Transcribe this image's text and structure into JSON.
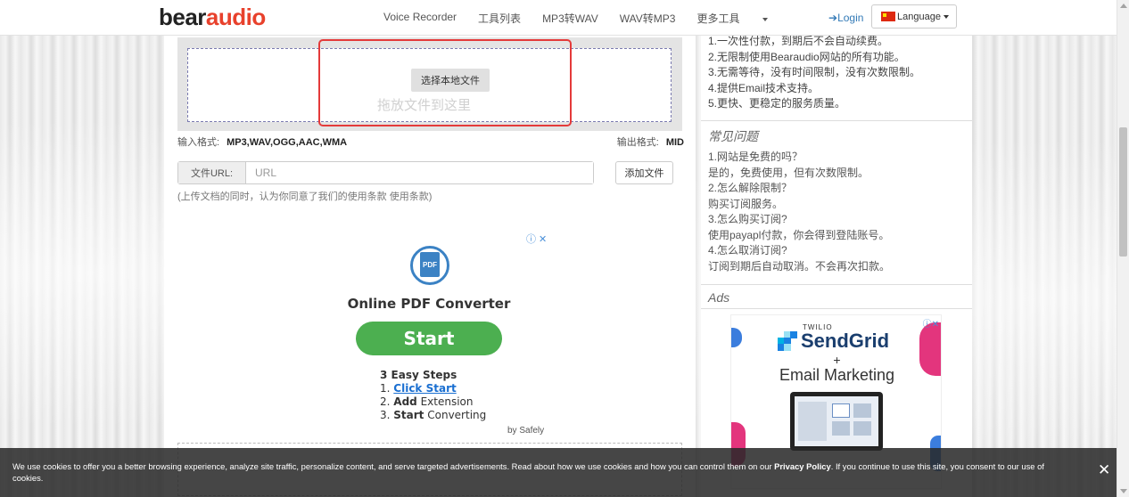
{
  "brand": {
    "logo_dark": "bear",
    "logo_accent": "audio",
    "accent_color": "#e8412c"
  },
  "nav": {
    "items": [
      "Voice Recorder",
      "工具列表",
      "MP3转WAV",
      "WAV转MP3"
    ],
    "more": "更多工具",
    "login": "Login",
    "language": "Language"
  },
  "upload": {
    "choose_button": "选择本地文件",
    "drop_hint": "拖放文件到这里",
    "input_format_label": "输入格式:",
    "input_formats": "MP3,WAV,OGG,AAC,WMA",
    "output_format_label": "输出格式:",
    "output_format": "MID",
    "url_label": "文件URL:",
    "url_placeholder": "URL",
    "add_button": "添加文件",
    "terms": "(上传文档的同时，认为你同意了我们的使用条款 使用条款)"
  },
  "ad_main": {
    "icon_text": "PDF",
    "title": "Online PDF Converter",
    "cta": "Start",
    "steps_title": "3 Easy Steps",
    "step1_num": "1.",
    "step1": "Click Start",
    "step2_num": "2.",
    "step2_bold": "Add",
    "step2_rest": "Extension",
    "step3_num": "3.",
    "step3_bold": "Start",
    "step3_rest": "Converting",
    "by": "by Safely"
  },
  "sidebar": {
    "benefits": [
      "1.一次性付款，到期后不会自动续费。",
      "2.无限制使用Bearaudio网站的所有功能。",
      "3.无需等待，没有时间限制，没有次数限制。",
      "4.提供Email技术支持。",
      "5.更快、更稳定的服务质量。"
    ],
    "faq_title": "常见问题",
    "faq": [
      {
        "q": "1.网站是免费的吗？",
        "a": "是的，免费使用，但有次数限制。"
      },
      {
        "q": "2.怎么解除限制？",
        "a": "购买订阅服务。"
      },
      {
        "q": "3.怎么购买订阅?",
        "a": "使用payapl付款，你会得到登陆账号。"
      },
      {
        "q": "4.怎么取消订阅?",
        "a": "订阅到期后自动取消。不会再次扣款。"
      }
    ],
    "ads_title": "Ads",
    "ad": {
      "brand_small": "TWILIO",
      "brand": "SendGrid",
      "plus": "+",
      "tagline": "Email Marketing"
    }
  },
  "cookie": {
    "text_before": "We use cookies to offer you a better browsing experience, analyze site traffic, personalize content, and serve targeted advertisements. Read about how we use cookies and how you can control them on our ",
    "policy_link": "Privacy Policy",
    "text_after": ". If you continue to use this site, you consent to our use of cookies.",
    "close": "✕"
  },
  "colors": {
    "link": "#337ab7",
    "highlight_border": "#e43a3a",
    "cta_green": "#4caf50",
    "cookie_bg": "#282828"
  }
}
